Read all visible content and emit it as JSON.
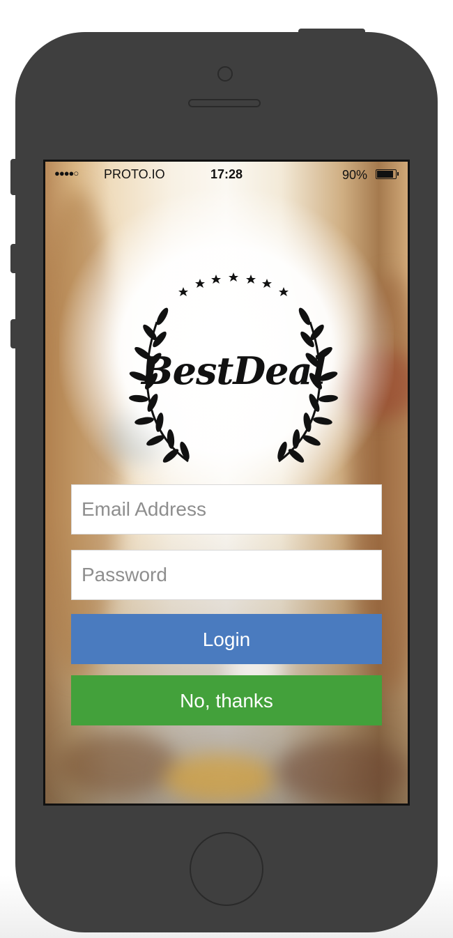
{
  "status_bar": {
    "signal": "●●●●○",
    "carrier": "PROTO.IO",
    "time": "17:28",
    "battery_percent": "90%",
    "battery_level": 0.9
  },
  "logo": {
    "text": "BestDeal",
    "icon": "laurel-wreath-icon",
    "stars": 7
  },
  "form": {
    "email_placeholder": "Email Address",
    "email_value": "",
    "password_placeholder": "Password",
    "password_value": ""
  },
  "buttons": {
    "login_label": "Login",
    "login_color": "#4a7bbf",
    "no_thanks_label": "No, thanks",
    "no_thanks_color": "#43a13b"
  }
}
